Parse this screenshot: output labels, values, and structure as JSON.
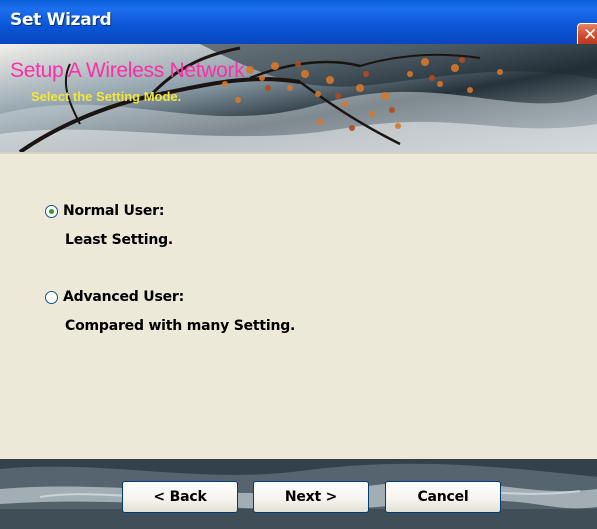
{
  "window": {
    "title": "Set Wizard"
  },
  "banner": {
    "title": "Setup A Wireless Network",
    "subtitle": "Select the Setting Mode."
  },
  "options": [
    {
      "label": "Normal User:",
      "description": "Least Setting.",
      "selected": true
    },
    {
      "label": "Advanced User:",
      "description": "Compared with many Setting.",
      "selected": false
    }
  ],
  "buttons": {
    "back": "< Back",
    "next": "Next >",
    "cancel": "Cancel"
  },
  "colors": {
    "titlebar": "#0b56d6",
    "banner_title": "#ff2ea8",
    "banner_subtitle": "#f5e63b",
    "body_bg": "#ece9d8"
  },
  "icons": {
    "close": "close-icon"
  }
}
